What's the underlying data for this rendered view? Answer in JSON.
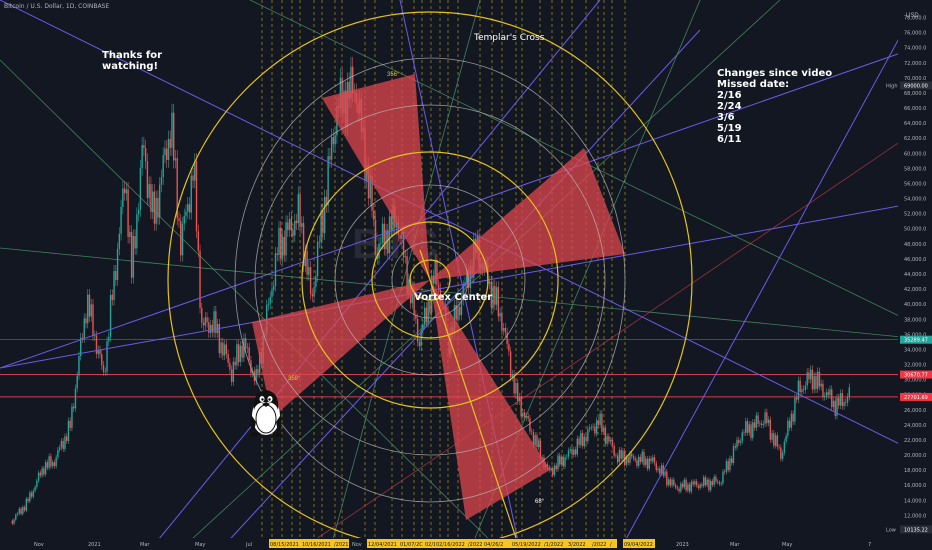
{
  "header": {
    "title": "Bitcoin / U.S. Dollar, 1D, COINBASE"
  },
  "annotations": {
    "thanks": "Thanks for watching!",
    "templar": "Templar's Cross",
    "changes": "Changes since video\nMissed date:\n2/16\n2/24\n3/6\n5/19\n6/11",
    "vortex": "Vortex Center",
    "deg_top": "356°",
    "deg_left": "358°",
    "deg_bottom": "68°"
  },
  "colors": {
    "background": "#131722",
    "circle_yellow": "#e6c21a",
    "circle_gray": "#b8b8b8",
    "wedge": "#e0474f",
    "trend_purple": "#6b5be6",
    "trend_green": "#4f9a6b",
    "hline_red": "#d43d4b",
    "vline_yellow": "#c9b42a"
  },
  "chart_data": {
    "type": "candlestick",
    "title": "Bitcoin / U.S. Dollar, 1D, COINBASE",
    "unit": "USD",
    "y_ticks": [
      10000,
      12000,
      14000,
      16000,
      18000,
      20000,
      22000,
      24000,
      26000,
      28000,
      30000,
      32000,
      34000,
      36000,
      38000,
      40000,
      42000,
      44000,
      46000,
      48000,
      50000,
      52000,
      54000,
      56000,
      58000,
      60000,
      62000,
      64000,
      66000,
      68000,
      70000,
      72000,
      74000,
      76000,
      78000
    ],
    "ylim": [
      9000,
      79000
    ],
    "x_ticks": [
      "Nov",
      "2021",
      "Mar",
      "May",
      "Jul",
      "Nov",
      "2023",
      "Mar",
      "May",
      "7"
    ],
    "date_labels": [
      "08/15/2021",
      "10/16/2021",
      "/2021",
      "12/04/2021",
      "01/07/2C",
      "02/1",
      "02/16/2022",
      "/2022",
      "04/26/2",
      "05/19/2022",
      "/1/2022",
      "3/2022",
      "/2022",
      "/",
      "09/04/2022"
    ],
    "price_labels": [
      {
        "label": "High",
        "value": "69000.00"
      },
      {
        "label": "",
        "value": "35289.47"
      },
      {
        "label": "",
        "value": "30670.77"
      },
      {
        "label": "",
        "value": "27701.69"
      },
      {
        "label": "Low",
        "value": "10135.22"
      }
    ],
    "horizontal_levels": [
      30670.77,
      27701.69
    ],
    "price_path": [
      [
        "2020-10-15",
        11300
      ],
      [
        "2020-11-01",
        13700
      ],
      [
        "2020-11-20",
        18500
      ],
      [
        "2020-12-01",
        19000
      ],
      [
        "2020-12-20",
        23800
      ],
      [
        "2021-01-08",
        40500
      ],
      [
        "2021-01-27",
        30500
      ],
      [
        "2021-02-21",
        57000
      ],
      [
        "2021-02-28",
        44000
      ],
      [
        "2021-03-13",
        61000
      ],
      [
        "2021-03-25",
        51000
      ],
      [
        "2021-04-14",
        64000
      ],
      [
        "2021-04-25",
        48000
      ],
      [
        "2021-05-10",
        58000
      ],
      [
        "2021-05-19",
        37000
      ],
      [
        "2021-06-01",
        37500
      ],
      [
        "2021-06-22",
        31000
      ],
      [
        "2021-07-05",
        35000
      ],
      [
        "2021-07-20",
        29800
      ],
      [
        "2021-08-14",
        47500
      ],
      [
        "2021-09-07",
        52000
      ],
      [
        "2021-09-21",
        40500
      ],
      [
        "2021-10-20",
        66000
      ],
      [
        "2021-11-10",
        69000
      ],
      [
        "2021-11-28",
        53500
      ],
      [
        "2021-12-04",
        47000
      ],
      [
        "2021-12-27",
        51500
      ],
      [
        "2022-01-22",
        35000
      ],
      [
        "2022-02-10",
        44500
      ],
      [
        "2022-02-24",
        35000
      ],
      [
        "2022-03-28",
        47500
      ],
      [
        "2022-04-26",
        38000
      ],
      [
        "2022-05-12",
        28000
      ],
      [
        "2022-06-18",
        17700
      ],
      [
        "2022-07-15",
        20500
      ],
      [
        "2022-08-14",
        24500
      ],
      [
        "2022-09-04",
        19800
      ],
      [
        "2022-10-15",
        19100
      ],
      [
        "2022-11-09",
        15700
      ],
      [
        "2022-12-31",
        16500
      ],
      [
        "2023-01-25",
        23000
      ],
      [
        "2023-02-20",
        24800
      ],
      [
        "2023-03-10",
        20000
      ],
      [
        "2023-03-30",
        28500
      ],
      [
        "2023-04-14",
        30500
      ],
      [
        "2023-05-12",
        26500
      ],
      [
        "2023-05-28",
        28000
      ]
    ]
  }
}
